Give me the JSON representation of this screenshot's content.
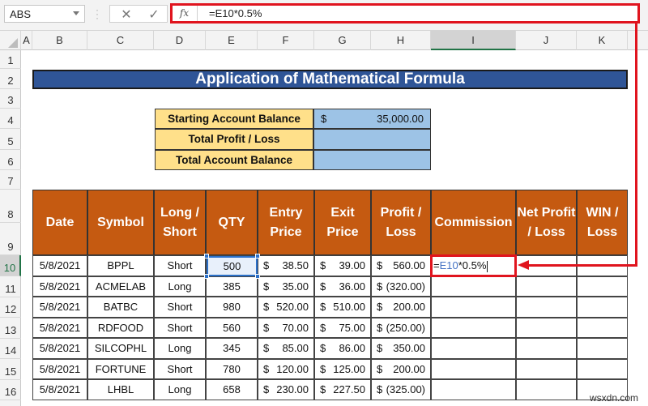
{
  "formula_bar": {
    "name_box": "ABS",
    "cancel_icon": "✕",
    "enter_icon": "✓",
    "fx_label": "fx",
    "formula": "=E10*0.5%"
  },
  "columns": [
    "A",
    "B",
    "C",
    "D",
    "E",
    "F",
    "G",
    "H",
    "I",
    "J",
    "K"
  ],
  "selected_column": "I",
  "rows": [
    "1",
    "2",
    "3",
    "4",
    "5",
    "6",
    "7",
    "8",
    "9",
    "10",
    "11",
    "12",
    "13",
    "14",
    "15",
    "16"
  ],
  "selected_row": "10",
  "title": "Application of Mathematical Formula",
  "summary": [
    {
      "label": "Starting Account Balance",
      "currency": "$",
      "value": "35,000.00"
    },
    {
      "label": "Total Profit / Loss",
      "currency": "",
      "value": ""
    },
    {
      "label": "Total Account Balance",
      "currency": "",
      "value": ""
    }
  ],
  "table": {
    "headers": [
      "Date",
      "Symbol",
      "Long / Short",
      "QTY",
      "Entry Price",
      "Exit Price",
      "Profit / Loss",
      "Commission",
      "Net Profit / Loss",
      "WIN / Loss"
    ],
    "rows": [
      {
        "date": "5/8/2021",
        "symbol": "BPPL",
        "side": "Short",
        "qty": "500",
        "entry": "38.50",
        "exit": "39.00",
        "pl": "560.00",
        "commission": "",
        "net": "",
        "win": ""
      },
      {
        "date": "5/8/2021",
        "symbol": "ACMELAB",
        "side": "Long",
        "qty": "385",
        "entry": "35.00",
        "exit": "36.00",
        "pl": "(320.00)",
        "commission": "",
        "net": "",
        "win": ""
      },
      {
        "date": "5/8/2021",
        "symbol": "BATBC",
        "side": "Short",
        "qty": "980",
        "entry": "520.00",
        "exit": "510.00",
        "pl": "200.00",
        "commission": "",
        "net": "",
        "win": ""
      },
      {
        "date": "5/8/2021",
        "symbol": "RDFOOD",
        "side": "Short",
        "qty": "560",
        "entry": "70.00",
        "exit": "75.00",
        "pl": "(250.00)",
        "commission": "",
        "net": "",
        "win": ""
      },
      {
        "date": "5/8/2021",
        "symbol": "SILCOPHL",
        "side": "Long",
        "qty": "345",
        "entry": "85.00",
        "exit": "86.00",
        "pl": "350.00",
        "commission": "",
        "net": "",
        "win": ""
      },
      {
        "date": "5/8/2021",
        "symbol": "FORTUNE",
        "side": "Short",
        "qty": "780",
        "entry": "120.00",
        "exit": "125.00",
        "pl": "200.00",
        "commission": "",
        "net": "",
        "win": ""
      },
      {
        "date": "5/8/2021",
        "symbol": "LHBL",
        "side": "Long",
        "qty": "658",
        "entry": "230.00",
        "exit": "227.50",
        "pl": "(325.00)",
        "commission": "",
        "net": "",
        "win": ""
      }
    ],
    "currency": "$"
  },
  "editing_cell": {
    "prefix": "=",
    "ref": "E10",
    "rest": "*0.5%"
  },
  "colors": {
    "title_bg": "#2f5597",
    "header_bg": "#c55a11",
    "summary_label_bg": "#ffe08a",
    "summary_value_bg": "#9dc3e6",
    "highlight_red": "#e0141e",
    "ref_blue": "#4472c4"
  },
  "watermark": "wsxdn.com"
}
